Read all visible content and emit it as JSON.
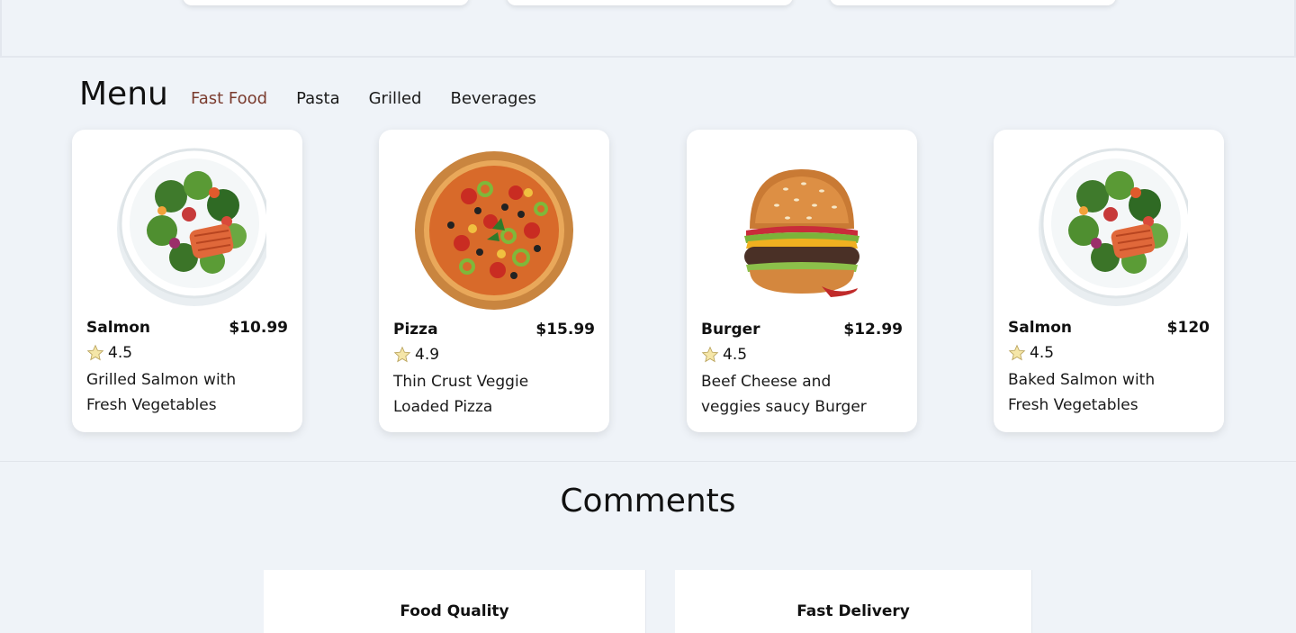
{
  "menu": {
    "title": "Menu",
    "tabs": [
      {
        "label": "Fast Food",
        "active": true
      },
      {
        "label": "Pasta",
        "active": false
      },
      {
        "label": "Grilled",
        "active": false
      },
      {
        "label": "Beverages",
        "active": false
      }
    ],
    "items": [
      {
        "name": "Salmon",
        "price": "$10.99",
        "rating": "4.5",
        "description": "Grilled Salmon with Fresh Vegetables",
        "image": "salmon-salad-image"
      },
      {
        "name": "Pizza",
        "price": "$15.99",
        "rating": "4.9",
        "description": "Thin Crust Veggie Loaded Pizza",
        "image": "pizza-image"
      },
      {
        "name": "Burger",
        "price": "$12.99",
        "rating": "4.5",
        "description": "Beef Cheese and veggies saucy Burger",
        "image": "burger-image"
      },
      {
        "name": "Salmon",
        "price": "$120",
        "rating": "4.5",
        "description": "Baked Salmon with Fresh Vegetables",
        "image": "salmon-salad-image"
      }
    ]
  },
  "comments": {
    "title": "Comments",
    "cards": [
      {
        "heading": "Food Quality"
      },
      {
        "heading": "Fast Delivery"
      }
    ]
  },
  "colors": {
    "background": "#eff3f8",
    "active_tab": "#7a3b2e",
    "card": "#ffffff",
    "star": "#f5e6a8"
  }
}
